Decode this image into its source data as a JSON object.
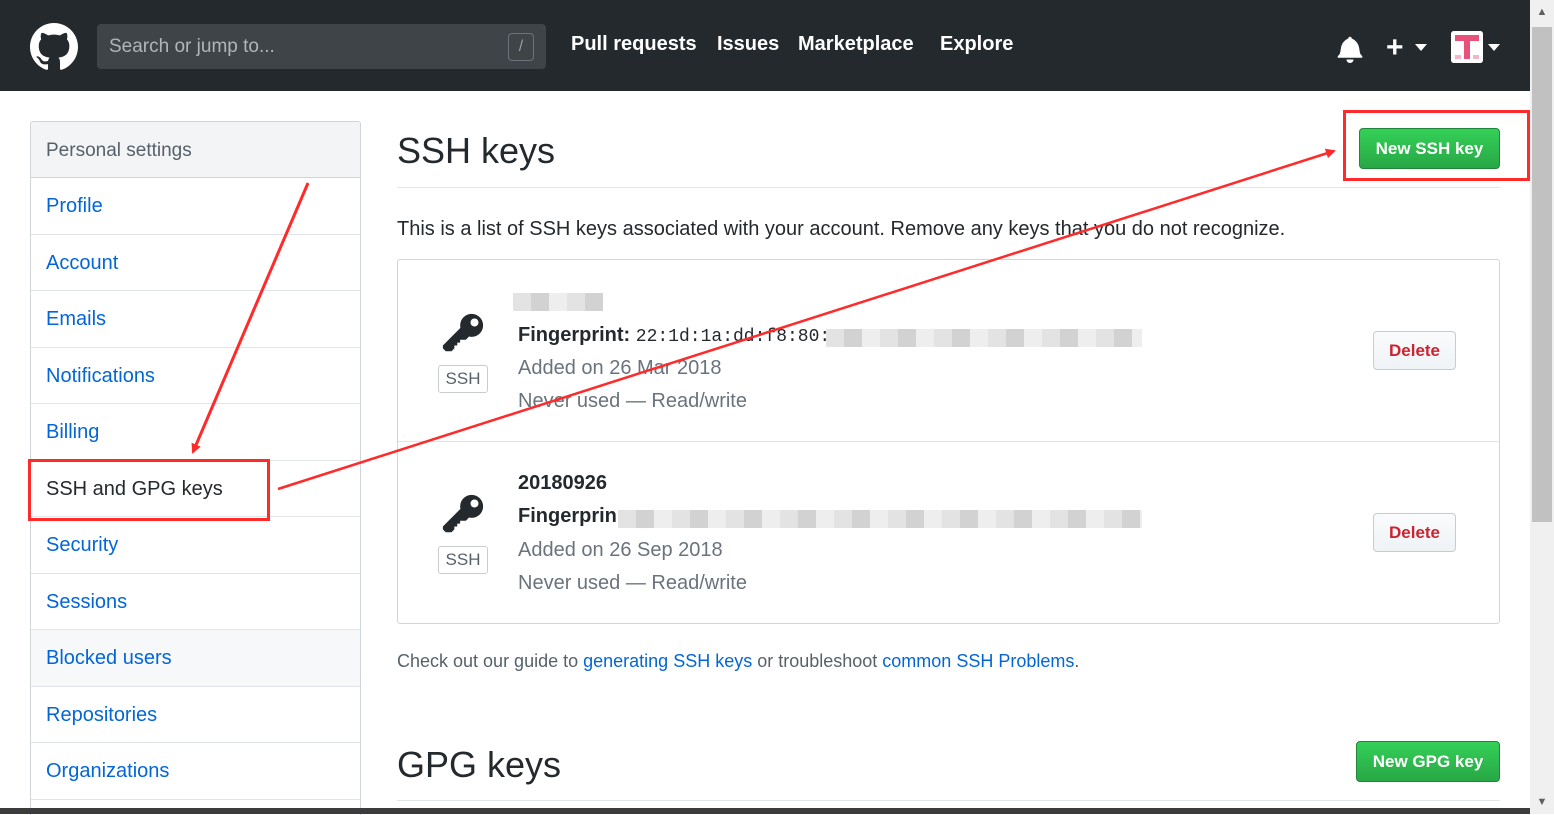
{
  "header": {
    "search_placeholder": "Search or jump to...",
    "search_shortcut": "/",
    "nav": [
      "Pull requests",
      "Issues",
      "Marketplace",
      "Explore"
    ],
    "avatar_letter": "T",
    "colors": {
      "background": "#24292e",
      "avatar_accent": "#e8527a"
    }
  },
  "sidebar": {
    "heading": "Personal settings",
    "items": [
      {
        "label": "Profile"
      },
      {
        "label": "Account"
      },
      {
        "label": "Emails"
      },
      {
        "label": "Notifications"
      },
      {
        "label": "Billing"
      },
      {
        "label": "SSH and GPG keys",
        "active": true
      },
      {
        "label": "Security"
      },
      {
        "label": "Sessions"
      },
      {
        "label": "Blocked users"
      },
      {
        "label": "Repositories"
      },
      {
        "label": "Organizations"
      }
    ]
  },
  "ssh": {
    "title": "SSH keys",
    "new_button": "New SSH key",
    "intro": "This is a list of SSH keys associated with your account. Remove any keys that you do not recognize.",
    "keys": [
      {
        "name": "",
        "badge": "SSH",
        "fingerprint_label": "Fingerprint:",
        "fingerprint": "22:1d:1a:dd:f8:80:",
        "added": "Added on 26 Mar 2018",
        "usage": "Never used — Read/write",
        "delete_label": "Delete"
      },
      {
        "name": "20180926",
        "badge": "SSH",
        "fingerprint_label": "Fingerprin",
        "fingerprint": "",
        "added": "Added on 26 Sep 2018",
        "usage": "Never used — Read/write",
        "delete_label": "Delete"
      }
    ],
    "guide": {
      "prefix": "Check out our guide to ",
      "link1": "generating SSH keys",
      "middle": " or troubleshoot ",
      "link2": "common SSH Problems",
      "suffix": "."
    }
  },
  "gpg": {
    "title": "GPG keys",
    "new_button": "New GPG key"
  },
  "colors": {
    "link": "#0366d6",
    "green_button": "#28a745",
    "delete_text": "#cb2431",
    "annotation": "#ff2a2a"
  }
}
